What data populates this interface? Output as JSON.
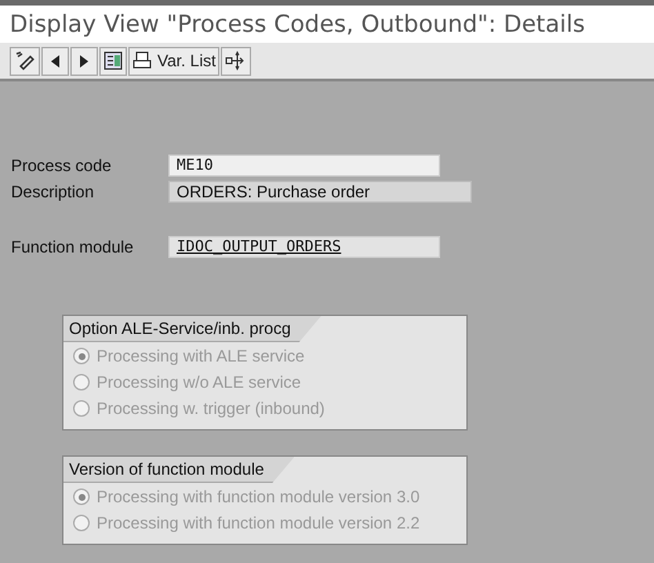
{
  "window": {
    "title": "Display View \"Process Codes, Outbound\": Details"
  },
  "toolbar": {
    "var_list": "Var. List"
  },
  "fields": [
    {
      "label": "Process code",
      "value": "ME10",
      "kind": "input"
    },
    {
      "label": "Description",
      "value": "ORDERS: Purchase order",
      "kind": "display"
    },
    {
      "label": "Function module",
      "value": "IDOC_OUTPUT_ORDERS",
      "kind": "link"
    }
  ],
  "groups": [
    {
      "title": "Option ALE-Service/inb. procg",
      "options": [
        {
          "label": "Processing with ALE service",
          "selected": true,
          "disabled": true
        },
        {
          "label": "Processing w/o ALE service",
          "selected": false,
          "disabled": true
        },
        {
          "label": "Processing w. trigger (inbound)",
          "selected": false,
          "disabled": true
        }
      ]
    },
    {
      "title": "Version of function module",
      "options": [
        {
          "label": "Processing with function module version 3.0",
          "selected": true,
          "disabled": true
        },
        {
          "label": "Processing with function module version 2.2",
          "selected": false,
          "disabled": true
        }
      ]
    }
  ]
}
